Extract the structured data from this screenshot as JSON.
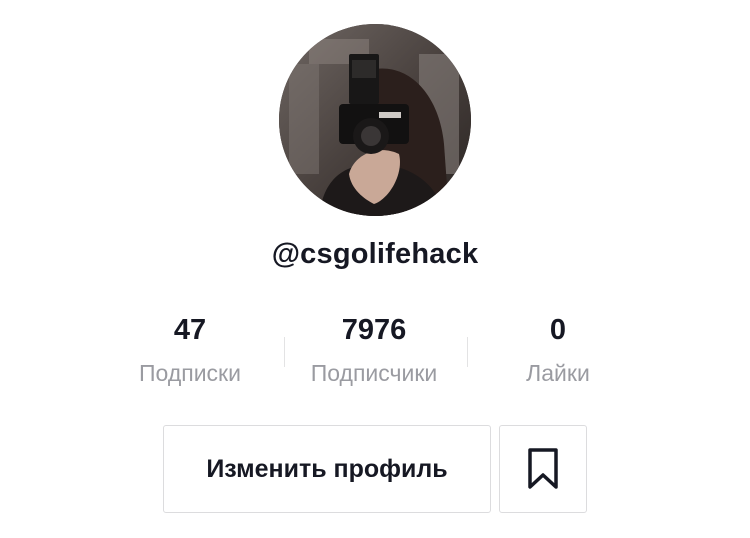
{
  "profile": {
    "username": "@csgolifehack",
    "avatar_icon": "profile-photo-avatar"
  },
  "stats": {
    "following": {
      "value": "47",
      "label": "Подписки"
    },
    "followers": {
      "value": "7976",
      "label": "Подписчики"
    },
    "likes": {
      "value": "0",
      "label": "Лайки"
    }
  },
  "actions": {
    "edit_profile_label": "Изменить профиль",
    "bookmark_icon": "bookmark-icon"
  },
  "colors": {
    "text_primary": "#161823",
    "text_secondary": "#9a9ba1",
    "border": "#dcdcde"
  }
}
